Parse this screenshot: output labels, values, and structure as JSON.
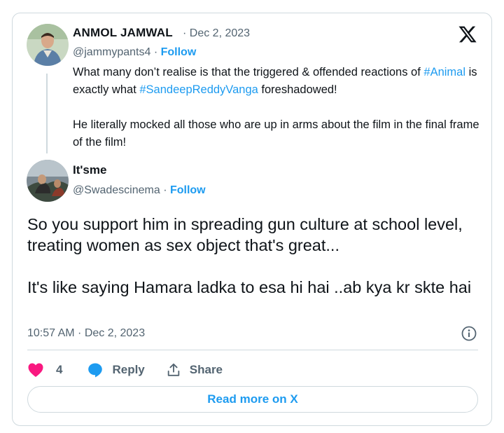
{
  "quoted_tweet": {
    "author_name": "ANMOL JAMWAL",
    "date": "· Dec 2, 2023",
    "handle": "@jammypants4",
    "separator": " · ",
    "follow_label": "Follow",
    "text_p1_before": "What many don’t realise is that the triggered & offended reactions of ",
    "hashtag1": "#Animal",
    "text_p1_middle": " is exactly what ",
    "hashtag2": "#SandeepReddyVanga",
    "text_p1_after": " foreshadowed!",
    "text_p2": "He literally mocked all those who are up in arms about the film in the final frame of the film!"
  },
  "main_tweet": {
    "author_name": "It'sme",
    "handle": "@Swadescinema",
    "separator": " · ",
    "follow_label": "Follow",
    "text_p1": "So you support him in spreading gun culture at school level, treating women as sex object that's great...",
    "text_p2": "It's like saying Hamara ladka to esa hi hai ..ab kya kr skte hai",
    "timestamp": "10:57 AM · Dec 2, 2023"
  },
  "actions": {
    "like_count": "4",
    "reply_label": "Reply",
    "share_label": "Share"
  },
  "read_more_label": "Read more on X",
  "colors": {
    "accent": "#1d9bf0",
    "like": "#f91880",
    "muted": "#536471",
    "border": "#cfd9de"
  },
  "icons": [
    "x-logo-icon",
    "info-icon",
    "heart-icon",
    "reply-bubble-icon",
    "share-icon"
  ]
}
